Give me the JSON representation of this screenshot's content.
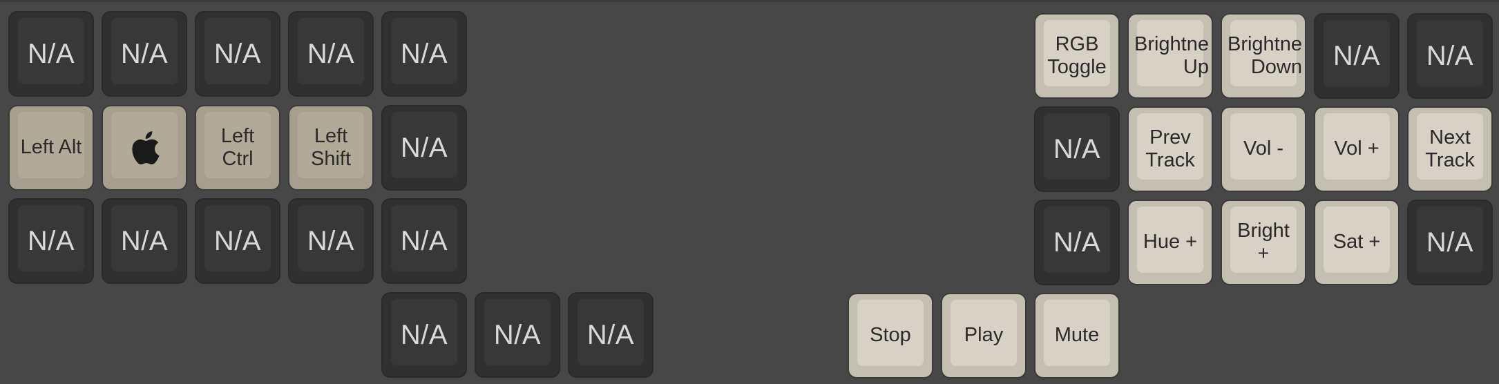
{
  "keyboard": {
    "left": {
      "row1": [
        "N/A",
        "N/A",
        "N/A",
        "N/A",
        "N/A"
      ],
      "row2": [
        "Left Alt",
        "",
        "Left\nCtrl",
        "Left\nShift",
        "N/A"
      ],
      "row3": [
        "N/A",
        "N/A",
        "N/A",
        "N/A",
        "N/A"
      ],
      "thumb": [
        "N/A",
        "N/A",
        "N/A"
      ]
    },
    "right": {
      "row1": [
        "RGB\nToggle",
        "Brightne\nUp",
        "Brightne\nDown",
        "N/A",
        "N/A"
      ],
      "row2": [
        "N/A",
        "Prev\nTrack",
        "Vol -",
        "Vol +",
        "Next\nTrack"
      ],
      "row3": [
        "N/A",
        "Hue +",
        "Bright\n+",
        "Sat +",
        "N/A"
      ],
      "thumb": [
        "Stop",
        "Play",
        "Mute"
      ]
    },
    "icons": {
      "apple_key": "apple-logo-icon"
    },
    "colors": {
      "background": "#474747",
      "na_key": "#303030",
      "modifier_key": "#a69f8f",
      "media_key": "#c4bfb1",
      "legend_light": "#d9d9d9",
      "legend_dark": "#2a2a2a"
    }
  }
}
